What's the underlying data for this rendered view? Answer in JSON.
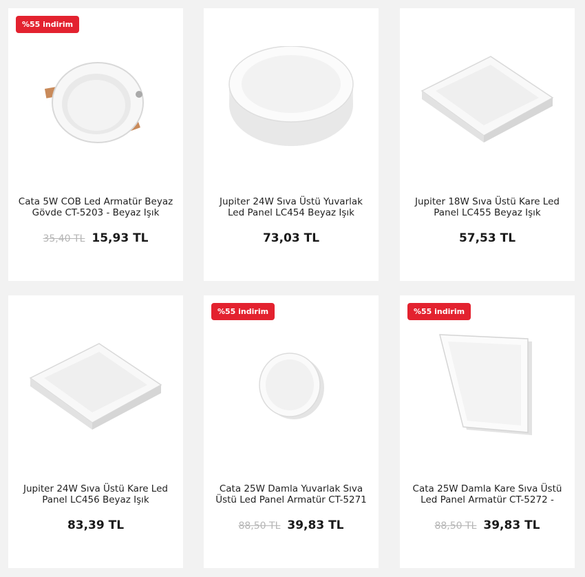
{
  "products": [
    {
      "badge": "%55 indirim",
      "title": "Cata 5W COB Led Armatür Beyaz Gövde CT-5203 - Beyaz Işık",
      "old_price": "35,40 TL",
      "price": "15,93 TL",
      "image_icon": "round-recessed-downlight"
    },
    {
      "badge": "",
      "title": "Jupiter 24W Sıva Üstü Yuvarlak Led Panel LC454 Beyaz Işık",
      "old_price": "",
      "price": "73,03 TL",
      "image_icon": "round-surface-panel"
    },
    {
      "badge": "",
      "title": "Jupiter 18W Sıva Üstü Kare Led Panel LC455 Beyaz Işık",
      "old_price": "",
      "price": "57,53 TL",
      "image_icon": "square-surface-panel"
    },
    {
      "badge": "",
      "title": "Jupiter 24W Sıva Üstü Kare Led Panel LC456 Beyaz Işık",
      "old_price": "",
      "price": "83,39 TL",
      "image_icon": "square-surface-panel"
    },
    {
      "badge": "%55 indirim",
      "title": "Cata 25W Damla Yuvarlak Sıva Üstü Led Panel Armatür CT-5271",
      "old_price": "88,50 TL",
      "price": "39,83 TL",
      "image_icon": "round-small-panel"
    },
    {
      "badge": "%55 indirim",
      "title": "Cata 25W Damla Kare Sıva Üstü Led Panel Armatür CT-5272 -",
      "old_price": "88,50 TL",
      "price": "39,83 TL",
      "image_icon": "square-flat-panel"
    }
  ],
  "colors": {
    "badge": "#e3222f",
    "page_bg": "#f2f2f2",
    "card_bg": "#ffffff",
    "old_price": "#b5b5b5"
  }
}
